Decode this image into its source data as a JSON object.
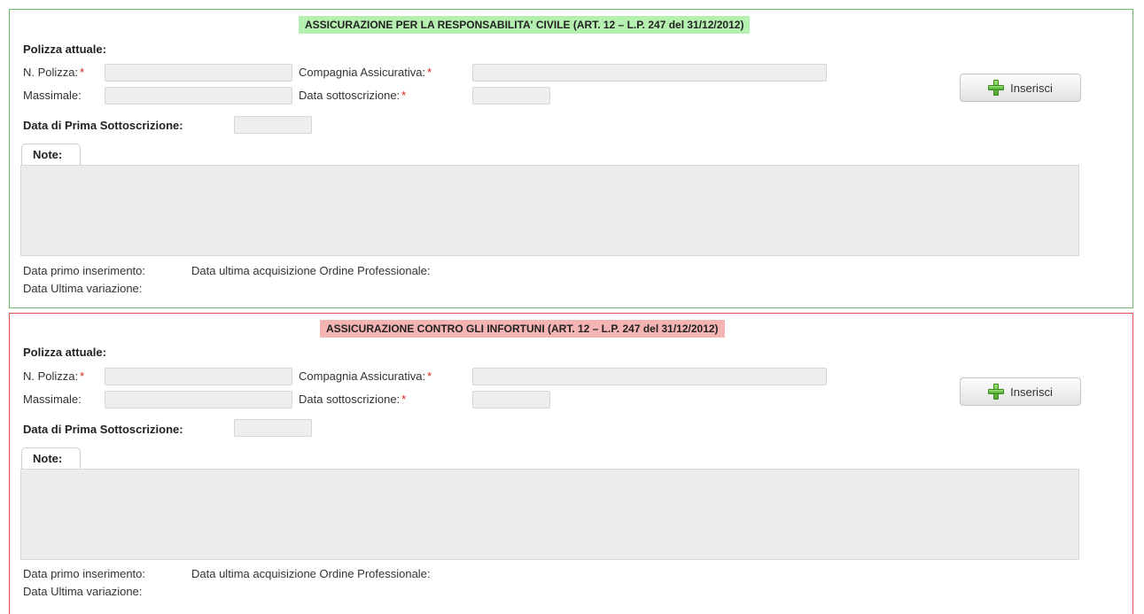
{
  "sections": [
    {
      "title": "ASSICURAZIONE PER LA RESPONSABILITA' CIVILE (ART. 12 – L.P. 247 del 31/12/2012)",
      "heading": "Polizza attuale:",
      "policy_number_label": "N. Polizza:",
      "insurer_label": "Compagnia Assicurativa:",
      "ceiling_label": "Massimale:",
      "subscription_date_label": "Data sottoscrizione:",
      "required_mark": "*",
      "first_subscription_label": "Data di Prima Sottoscrizione:",
      "insert_button_label": "Inserisci",
      "notes_tab_label": "Note:",
      "first_insert_label": "Data primo inserimento:",
      "last_acquisition_label": "Data ultima acquisizione Ordine Professionale:",
      "last_change_label": "Data Ultima variazione:",
      "accent_color": "#b6f0b0",
      "border_color": "#6ab86a"
    },
    {
      "title": "ASSICURAZIONE CONTRO GLI INFORTUNI (ART. 12 – L.P. 247 del 31/12/2012)",
      "heading": "Polizza attuale:",
      "policy_number_label": "N. Polizza:",
      "insurer_label": "Compagnia Assicurativa:",
      "ceiling_label": "Massimale:",
      "subscription_date_label": "Data sottoscrizione:",
      "required_mark": "*",
      "first_subscription_label": "Data di Prima Sottoscrizione:",
      "insert_button_label": "Inserisci",
      "notes_tab_label": "Note:",
      "first_insert_label": "Data primo inserimento:",
      "last_acquisition_label": "Data ultima acquisizione Ordine Professionale:",
      "last_change_label": "Data Ultima variazione:",
      "accent_color": "#f5b4b4",
      "border_color": "#d9534f"
    }
  ],
  "icons": {
    "insert": "plus-icon"
  }
}
